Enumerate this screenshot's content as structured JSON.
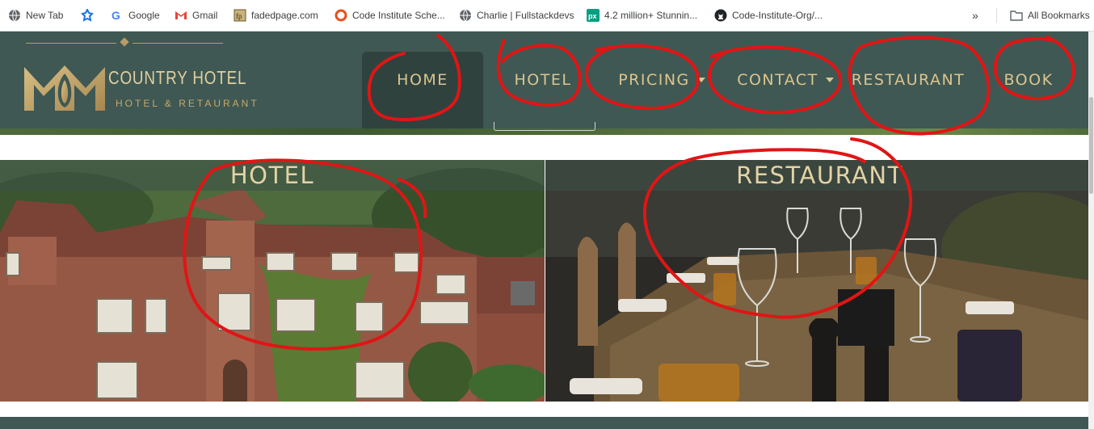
{
  "bookmarks": [
    {
      "label": "New Tab",
      "icon": "globe-icon"
    },
    {
      "label": "",
      "icon": "app-icon"
    },
    {
      "label": "Google",
      "icon": "google-icon"
    },
    {
      "label": "Gmail",
      "icon": "gmail-icon"
    },
    {
      "label": "fadedpage.com",
      "icon": "fadedpage-icon"
    },
    {
      "label": "Code Institute Sche...",
      "icon": "code-institute-icon"
    },
    {
      "label": "Charlie | Fullstackdevs",
      "icon": "globe-icon"
    },
    {
      "label": "4.2 million+ Stunnin...",
      "icon": "pexels-icon"
    },
    {
      "label": "Code-Institute-Org/...",
      "icon": "github-icon"
    }
  ],
  "bookmarks_overflow": "»",
  "all_bookmarks_label": "All Bookmarks",
  "logo": {
    "title": "COUNTRY HOTEL",
    "subtitle": "HOTEL & RETAURANT"
  },
  "nav": {
    "items": [
      {
        "label": "HOME",
        "active": true,
        "dropdown": false
      },
      {
        "label": "HOTEL",
        "active": false,
        "dropdown": false
      },
      {
        "label": "PRICING",
        "active": false,
        "dropdown": true
      },
      {
        "label": "CONTACT",
        "active": false,
        "dropdown": true
      },
      {
        "label": "RESTAURANT",
        "active": false,
        "dropdown": false
      },
      {
        "label": "BOOK",
        "active": false,
        "dropdown": false
      }
    ]
  },
  "panels": {
    "hotel": {
      "title": "HOTEL",
      "image": "hotel-building-photo"
    },
    "restaurant": {
      "title": "RESTAURANT",
      "image": "restaurant-table-photo"
    }
  },
  "colors": {
    "header_bg": "#3f5853",
    "nav_active_bg": "#2f423e",
    "gold_text": "#dcc48e",
    "annotation_red": "#e01515"
  }
}
